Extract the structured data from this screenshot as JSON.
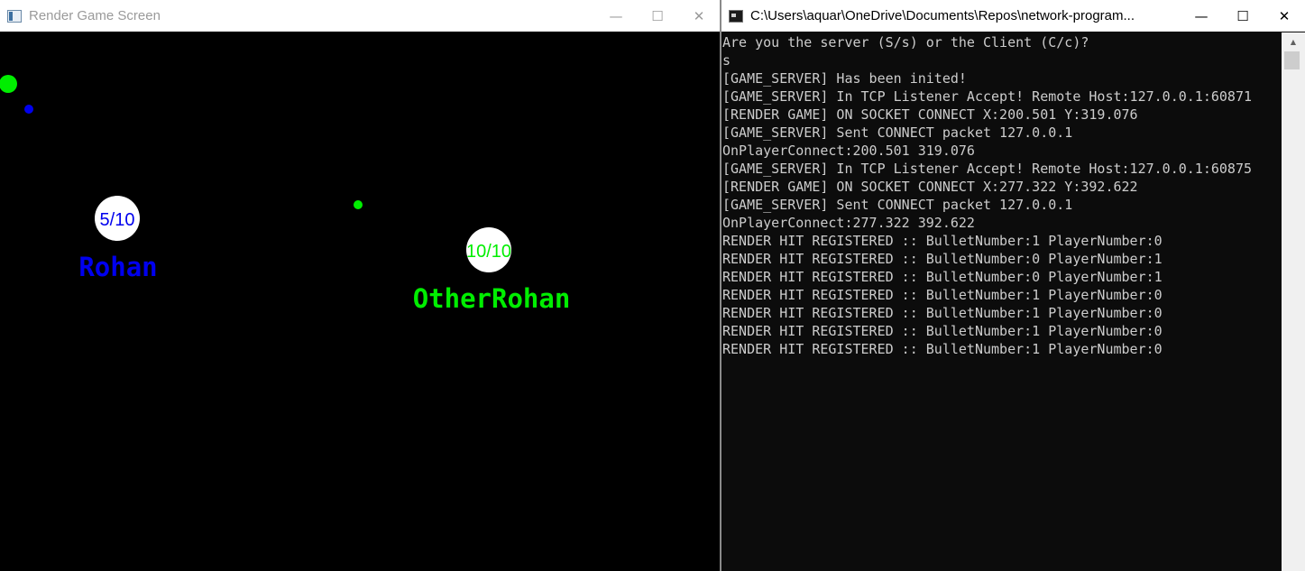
{
  "game_window": {
    "title": "Render Game Screen",
    "buttons": {
      "minimize": "—",
      "maximize": "☐",
      "close": "✕"
    },
    "players": [
      {
        "name": "Rohan",
        "health": "5/10",
        "color": "#0000ee"
      },
      {
        "name": "OtherRohan",
        "health": "10/10",
        "color": "#00ee00"
      }
    ],
    "bullet_colors": [
      "#00ee00",
      "#0000ee",
      "#00ee00"
    ]
  },
  "console_window": {
    "title": "C:\\Users\\aquar\\OneDrive\\Documents\\Repos\\network-program...",
    "buttons": {
      "minimize": "—",
      "maximize": "☐",
      "close": "✕"
    },
    "text_color": "#cccccc",
    "lines": [
      "Are you the server (S/s) or the Client (C/c)?",
      "s",
      "[GAME_SERVER] Has been inited!",
      "[GAME_SERVER] In TCP Listener Accept! Remote Host:127.0.0.1:60871",
      "[RENDER GAME] ON SOCKET CONNECT X:200.501 Y:319.076",
      "[GAME_SERVER] Sent CONNECT packet 127.0.0.1",
      "OnPlayerConnect:200.501 319.076",
      "[GAME_SERVER] In TCP Listener Accept! Remote Host:127.0.0.1:60875",
      "[RENDER GAME] ON SOCKET CONNECT X:277.322 Y:392.622",
      "[GAME_SERVER] Sent CONNECT packet 127.0.0.1",
      "OnPlayerConnect:277.322 392.622",
      "RENDER HIT REGISTERED :: BulletNumber:1 PlayerNumber:0",
      "RENDER HIT REGISTERED :: BulletNumber:0 PlayerNumber:1",
      "RENDER HIT REGISTERED :: BulletNumber:0 PlayerNumber:1",
      "RENDER HIT REGISTERED :: BulletNumber:1 PlayerNumber:0",
      "RENDER HIT REGISTERED :: BulletNumber:1 PlayerNumber:0",
      "RENDER HIT REGISTERED :: BulletNumber:1 PlayerNumber:0",
      "RENDER HIT REGISTERED :: BulletNumber:1 PlayerNumber:0"
    ]
  }
}
